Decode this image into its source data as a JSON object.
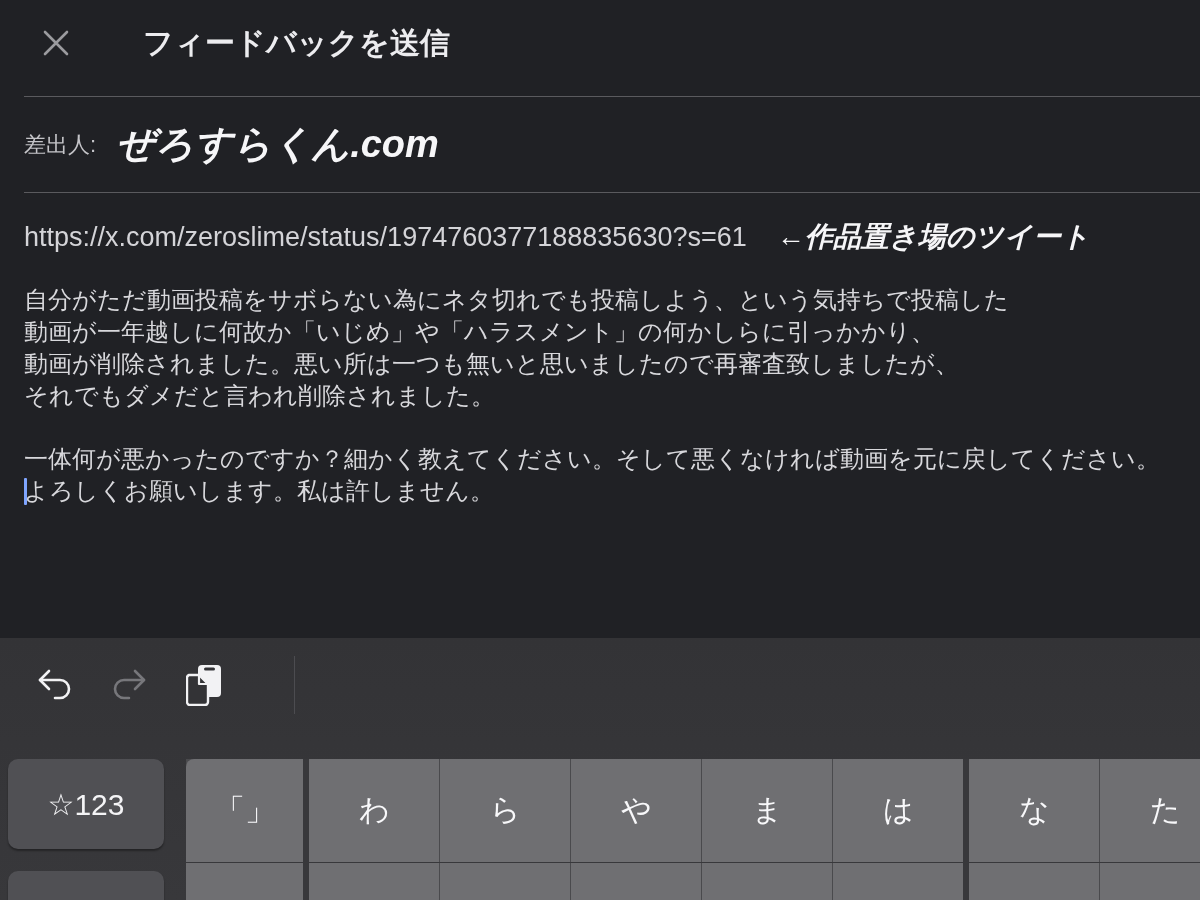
{
  "header": {
    "title": "フィードバックを送信"
  },
  "sender": {
    "label": "差出人:",
    "handwritten_value": "ぜろすらくん.com"
  },
  "message": {
    "url": "https://x.com/zeroslime/status/1974760377188835630?s=61",
    "handwritten_note": "←作品置き場のツイート",
    "paragraphs": [
      {
        "lines": [
          {
            "text": "自分がただ動画投稿をサボらない為にネタ切れでも投稿しよう、という気持ちで投稿した",
            "caret": false
          },
          {
            "text": "動画が一年越しに何故か「いじめ」や「ハラスメント」の何かしらに引っかかり、",
            "caret": false
          },
          {
            "text": "動画が削除されました。悪い所は一つも無いと思いましたので再審査致しましたが、",
            "caret": false
          },
          {
            "text": "それでもダメだと言われ削除されました。",
            "caret": false
          }
        ]
      },
      {
        "lines": [
          {
            "text": "一体何が悪かったのですか？細かく教えてください。そして悪くなければ動画を元に戻してください。",
            "caret": false
          },
          {
            "text": "よろしくお願いします。私は許しません。",
            "caret": true
          }
        ]
      }
    ]
  },
  "keyboard": {
    "toolbar": [
      {
        "kind": "undo",
        "disabled": false
      },
      {
        "kind": "redo",
        "disabled": true
      },
      {
        "kind": "clipboard",
        "disabled": false
      }
    ],
    "mode_key": "☆123",
    "key_groups": [
      [
        "「」"
      ],
      [
        "わ",
        "ら",
        "や",
        "ま",
        "は"
      ],
      [
        "な",
        "た"
      ]
    ]
  }
}
